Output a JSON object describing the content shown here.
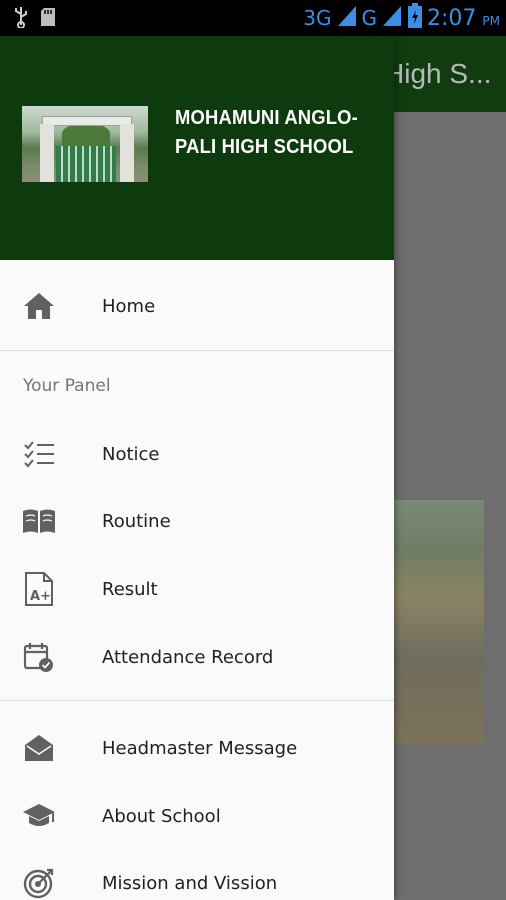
{
  "status_bar": {
    "network_3g": "3G",
    "network_g": "G",
    "time": "2:07",
    "ampm": "PM",
    "icons": [
      "usb-icon",
      "sdcard-icon",
      "signal-icon",
      "battery-icon"
    ]
  },
  "background_app": {
    "toolbar_title": "High S..."
  },
  "drawer": {
    "header": {
      "school_name": "MOHAMUNI ANGLO-PALI HIGH SCHOOL"
    },
    "home": {
      "label": "Home",
      "icon": "home-icon"
    },
    "section_title": "Your Panel",
    "panel_items": [
      {
        "label": "Notice",
        "icon": "checklist-icon"
      },
      {
        "label": "Routine",
        "icon": "book-icon"
      },
      {
        "label": "Result",
        "icon": "grade-document-icon"
      },
      {
        "label": "Attendance Record",
        "icon": "calendar-check-icon"
      }
    ],
    "info_items": [
      {
        "label": "Headmaster Message",
        "icon": "envelope-open-icon"
      },
      {
        "label": "About School",
        "icon": "graduation-cap-icon"
      },
      {
        "label": "Mission and Vission",
        "icon": "target-icon"
      }
    ]
  },
  "colors": {
    "header_green": "#0e3b0e",
    "status_blue": "#3a8ee6",
    "icon_grey": "#616161"
  }
}
